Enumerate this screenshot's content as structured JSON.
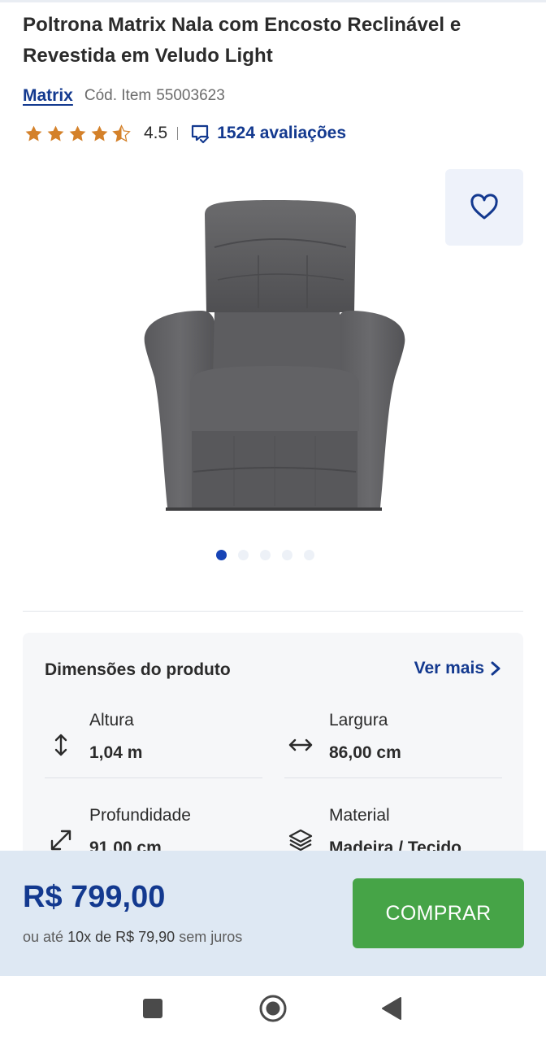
{
  "product": {
    "title_line1": "Poltrona Matrix Nala com Encosto Reclinável e",
    "title_line2": "Revestida em Veludo Light",
    "brand": "Matrix",
    "sku_label": "Cód. Item",
    "sku_number": "55003623",
    "rating": "4.5",
    "rating_stars": 4.5,
    "reviews_text": "1524 avaliações",
    "image_count": 5,
    "active_image": 1
  },
  "dimensions": {
    "title": "Dimensões do produto",
    "see_more": "Ver mais",
    "items": [
      {
        "label": "Altura",
        "value": "1,04 m",
        "icon": "vertical-arrows-icon"
      },
      {
        "label": "Largura",
        "value": "86,00 cm",
        "icon": "horizontal-arrows-icon"
      },
      {
        "label": "Profundidade",
        "value": "91,00 cm",
        "icon": "diagonal-arrows-icon"
      },
      {
        "label": "Material",
        "value": "Madeira / Tecido",
        "icon": "layers-icon"
      }
    ]
  },
  "purchase": {
    "price": "R$ 799,00",
    "installments_prefix": "ou até",
    "installments_value": "10x de R$ 79,90",
    "installments_suffix": "sem juros",
    "buy_label": "COMPRAR"
  },
  "colors": {
    "brand_blue": "#13398f",
    "buy_green": "#46a447",
    "star_orange": "#d4812a",
    "bar_background": "#dee8f3"
  }
}
